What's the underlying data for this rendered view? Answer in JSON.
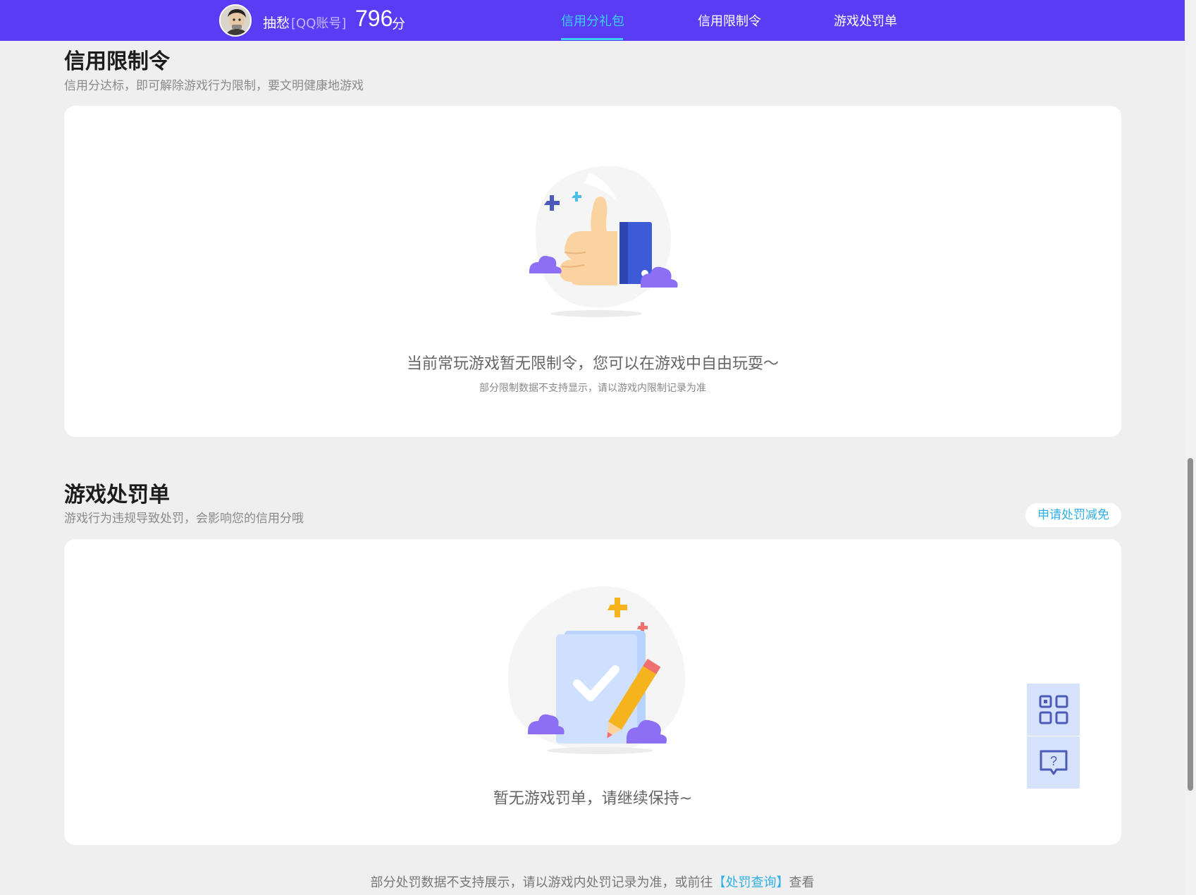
{
  "header": {
    "username": "抽愁",
    "account_type": "[QQ账号]",
    "score": "796",
    "score_unit": "分",
    "tabs": [
      {
        "label": "信用分礼包",
        "active": true
      },
      {
        "label": "信用限制令",
        "active": false
      },
      {
        "label": "游戏处罚单",
        "active": false
      }
    ],
    "bar_color": "#5b3cf5",
    "active_color": "#3ad0f5"
  },
  "restriction": {
    "title": "信用限制令",
    "subtitle": "信用分达标，即可解除游戏行为限制，要文明健康地游戏",
    "empty_message": "当前常玩游戏暂无限制令，您可以在游戏中自由玩耍～",
    "note": "部分限制数据不支持显示，请以游戏内限制记录为准",
    "illustration_icon": "thumbs-up-icon"
  },
  "penalty": {
    "title": "游戏处罚单",
    "subtitle": "游戏行为违规导致处罚，会影响您的信用分哦",
    "appeal_button": "申请处罚减免",
    "empty_message": "暂无游戏罚单，请继续保持~",
    "illustration_icon": "clipboard-check-icon"
  },
  "footer": {
    "prefix": "部分处罚数据不支持展示，请以游戏内处罚记录为准，或前往",
    "link": "【处罚查询】",
    "suffix": "查看"
  },
  "float_tools": [
    {
      "icon": "qr-code-icon"
    },
    {
      "icon": "help-chat-icon"
    }
  ]
}
